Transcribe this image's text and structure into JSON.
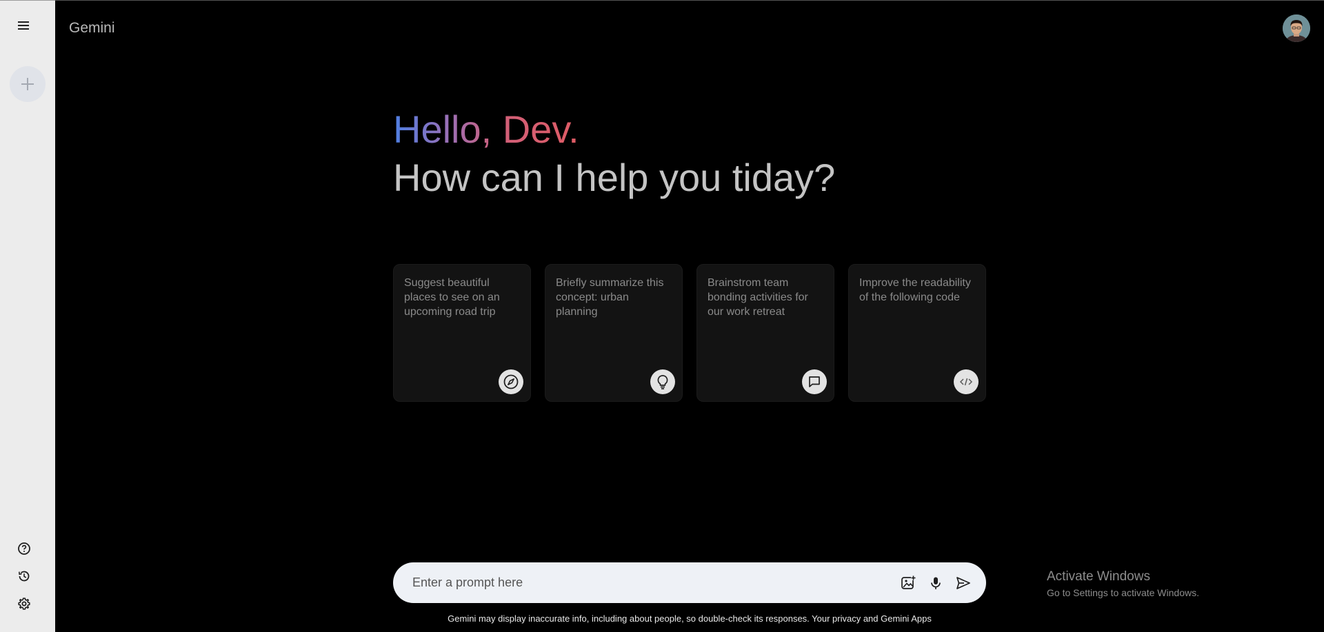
{
  "sidebar": {
    "menu_icon": "hamburger-menu-icon",
    "new_chat_icon": "plus-icon",
    "bottom_icons": [
      "help-icon",
      "history-icon",
      "settings-icon"
    ]
  },
  "header": {
    "brand": "Gemini"
  },
  "greeting": {
    "hello": "Hello, Dev.",
    "question": "How can I help you tiday?"
  },
  "cards": [
    {
      "text": "Suggest beautiful places to see on an upcoming road trip",
      "icon": "compass-icon"
    },
    {
      "text": "Briefly summarize this concept: urban planning",
      "icon": "lightbulb-icon"
    },
    {
      "text": "Brainstrom team bonding activities for our work retreat",
      "icon": "message-icon"
    },
    {
      "text": "Improve the readability of the following code",
      "icon": "code-icon"
    }
  ],
  "prompt": {
    "placeholder": "Enter a prompt here",
    "icons": [
      "image-upload-icon",
      "mic-icon",
      "send-icon"
    ]
  },
  "disclaimer": "Gemini may display inaccurate info, including about people, so double-check its responses. Your privacy and Gemini Apps",
  "watermark": {
    "title": "Activate Windows",
    "subtitle": "Go to Settings to activate Windows."
  },
  "colors": {
    "sidebar_bg": "#ececec",
    "main_bg": "#000000",
    "card_bg": "#131313",
    "prompt_bg": "#eef1f6",
    "gradient_start": "#4e7fe3",
    "gradient_end": "#df5b64"
  }
}
